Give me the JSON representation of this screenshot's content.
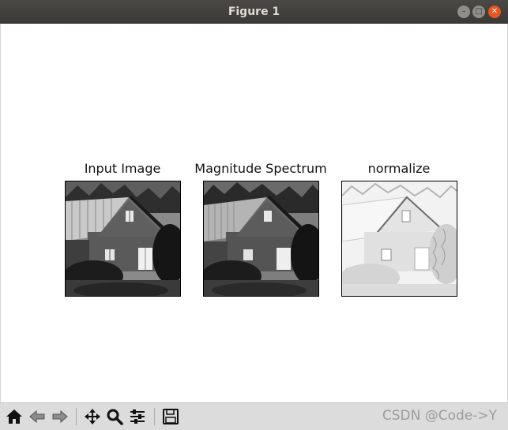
{
  "window": {
    "title": "Figure 1",
    "buttons": [
      "minimize",
      "maximize",
      "close"
    ]
  },
  "subplots": [
    {
      "title": "Input Image",
      "tone": "gray"
    },
    {
      "title": "Magnitude Spectrum",
      "tone": "gray"
    },
    {
      "title": "normalize",
      "tone": "inverted-edges"
    }
  ],
  "toolbar": {
    "tools": [
      "home-icon",
      "back-icon",
      "forward-icon",
      "pan-icon",
      "zoom-icon",
      "configure-subplots-icon",
      "save-icon"
    ]
  },
  "watermark": "CSDN @Code->Y"
}
